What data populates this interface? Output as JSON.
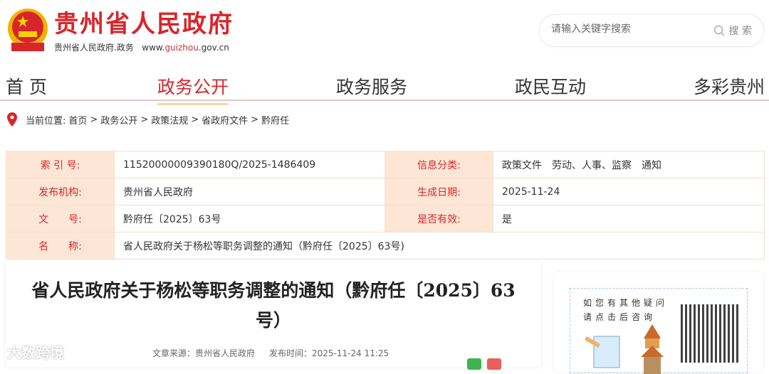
{
  "header": {
    "title": "贵州省人民政府",
    "subtitle": "贵州省人民政府.政务",
    "url_prefix": "www.",
    "url_mid": "guizhou",
    "url_suffix": ".gov.cn"
  },
  "search": {
    "placeholder": "请输入关键字搜索",
    "button": "搜 索"
  },
  "nav": [
    {
      "label": "首 页"
    },
    {
      "label": "政务公开",
      "active": true
    },
    {
      "label": "政务服务"
    },
    {
      "label": "政民互动"
    },
    {
      "label": "多彩贵州"
    }
  ],
  "breadcrumb": {
    "prefix": "当前位置:",
    "items": [
      "首页",
      "政务公开",
      "政策法规",
      "省政府文件",
      "黔府任"
    ]
  },
  "info": {
    "index_label": "索 引 号:",
    "index": "11520000009390180Q/2025-1486409",
    "category_label": "信息分类:",
    "category": "政策文件　劳动、人事、监察　通知",
    "org_label": "发布机构:",
    "org": "贵州省人民政府",
    "date_label": "生成日期:",
    "date": "2025-11-24",
    "docno_label": "文　　号:",
    "docno": "黔府任〔2025〕63号",
    "valid_label": "是否有效:",
    "valid": "是",
    "name_label": "名　　称:",
    "name": "省人民政府关于杨松等职务调整的通知（黔府任〔2025〕63号)"
  },
  "article": {
    "title": "省人民政府关于杨松等职务调整的通知（黔府任〔2025〕63号）",
    "source": "文章来源：贵州省人民政府",
    "time": "发布时间：2025-11-24 11:25"
  },
  "sidebar": {
    "line1": "如您有其他疑问",
    "line2": "请点击后咨询"
  },
  "watermark": "大数跨境",
  "colors": {
    "brand": "#d7262b",
    "label_bg": "#fde6d5"
  }
}
